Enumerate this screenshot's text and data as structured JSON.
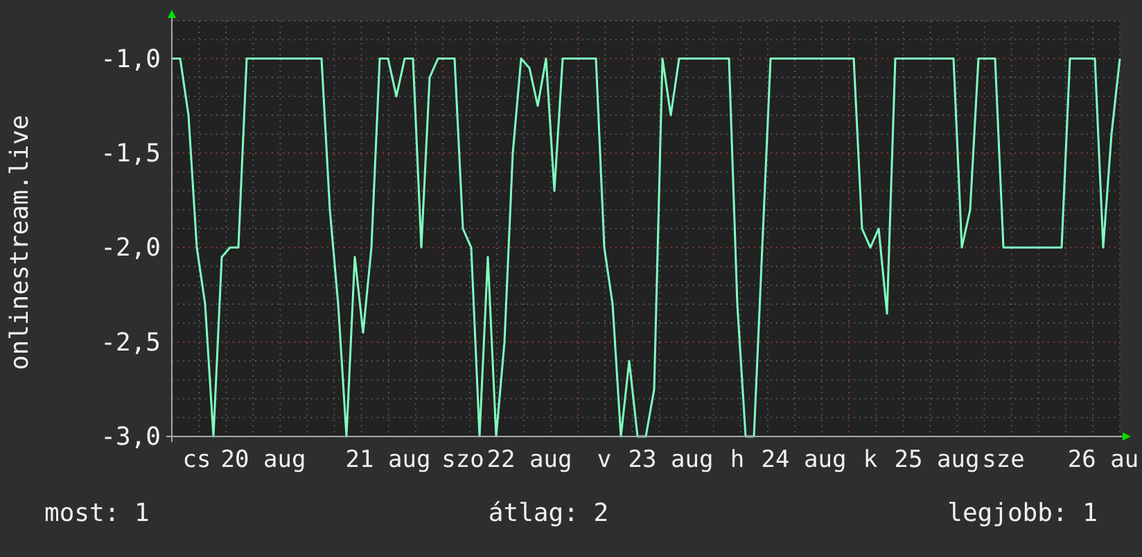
{
  "chart": {
    "chart_data": {
      "type": "line",
      "ylabel": "onlinestream.live",
      "ylim": [
        -3.0,
        -0.8
      ],
      "grid": true,
      "yticks": [
        {
          "value": -1.0,
          "label": "-1,0"
        },
        {
          "value": -1.5,
          "label": "-1,5"
        },
        {
          "value": -2.0,
          "label": "-2,0"
        },
        {
          "value": -2.5,
          "label": "-2,5"
        },
        {
          "value": -3.0,
          "label": "-3,0"
        }
      ],
      "categories": [
        null,
        null,
        null,
        "cs",
        null,
        null,
        null,
        null,
        null,
        null,
        null,
        "20 aug",
        null,
        null,
        null,
        null,
        null,
        null,
        null,
        null,
        null,
        null,
        null,
        null,
        null,
        null,
        "21 aug",
        null,
        null,
        null,
        null,
        null,
        null,
        null,
        null,
        "szo",
        null,
        null,
        null,
        null,
        null,
        null,
        null,
        "22 aug",
        null,
        null,
        null,
        null,
        null,
        null,
        null,
        null,
        "v",
        null,
        null,
        null,
        null,
        null,
        null,
        null,
        "23 aug",
        null,
        null,
        null,
        null,
        null,
        null,
        null,
        "h",
        null,
        null,
        null,
        null,
        null,
        null,
        null,
        "24 aug",
        null,
        null,
        null,
        null,
        null,
        null,
        null,
        "k",
        null,
        null,
        null,
        null,
        null,
        null,
        null,
        "25 aug",
        null,
        null,
        null,
        null,
        null,
        null,
        null,
        "sze",
        null,
        null,
        null,
        null,
        null,
        null,
        null,
        null,
        null,
        null,
        null,
        "26 au",
        null,
        null
      ],
      "series": [
        {
          "color": "#80ffc0",
          "values": [
            -1,
            -1,
            -1.3,
            -2,
            -2.3,
            -3,
            -2.05,
            -2,
            -2,
            -1,
            -1,
            -1,
            -1,
            -1,
            -1,
            -1,
            -1,
            -1,
            -1,
            -1.8,
            -2.3,
            -3,
            -2.05,
            -2.45,
            -2,
            -1,
            -1,
            -1.2,
            -1,
            -1,
            -2,
            -1.1,
            -1,
            -1,
            -1,
            -1.9,
            -2,
            -3,
            -2.05,
            -3,
            -2.5,
            -1.5,
            -1,
            -1.05,
            -1.25,
            -1,
            -1.7,
            -1,
            -1,
            -1,
            -1,
            -1,
            -2,
            -2.3,
            -3,
            -2.6,
            -3,
            -3,
            -2.75,
            -1,
            -1.3,
            -1,
            -1,
            -1,
            -1,
            -1,
            -1,
            -1,
            -2.3,
            -3,
            -3,
            -2,
            -1,
            -1,
            -1,
            -1,
            -1,
            -1,
            -1,
            -1,
            -1,
            -1,
            -1,
            -1.9,
            -2,
            -1.9,
            -2.35,
            -1,
            -1,
            -1,
            -1,
            -1,
            -1,
            -1,
            -1,
            -2,
            -1.8,
            -1,
            -1,
            -1,
            -2,
            -2,
            -2,
            -2,
            -2,
            -2,
            -2,
            -2,
            -1,
            -1,
            -1,
            -1,
            -2,
            -1.4,
            -1
          ]
        }
      ]
    }
  },
  "stats": [
    {
      "label": "most: 1"
    },
    {
      "label": "átlag: 2"
    },
    {
      "label": "legjobb: 1"
    }
  ]
}
